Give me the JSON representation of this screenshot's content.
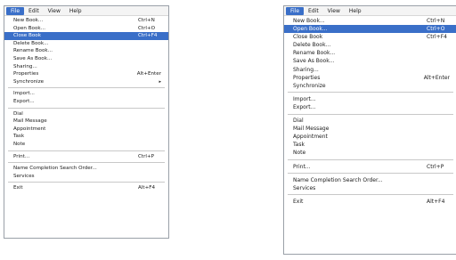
{
  "menubar": [
    "File",
    "Edit",
    "View",
    "Help"
  ],
  "left_panel": {
    "items": [
      {
        "label": "New Book...",
        "shortcut": "Ctrl+N"
      },
      {
        "label": "Open Book...",
        "shortcut": "Ctrl+O"
      },
      {
        "label": "Close Book",
        "shortcut": "Ctrl+F4"
      },
      {
        "label": "Delete Book..."
      },
      {
        "label": "Rename Book..."
      },
      {
        "label": "Save As Book..."
      },
      {
        "label": "Sharing..."
      },
      {
        "label": "Properties",
        "shortcut": "Alt+Enter"
      },
      {
        "label": "Synchronize",
        "arrow": "▸"
      },
      {
        "label": "Import..."
      },
      {
        "label": "Export..."
      },
      {
        "label": "Dial"
      },
      {
        "label": "Mail Message"
      },
      {
        "label": "Appointment"
      },
      {
        "label": "Task"
      },
      {
        "label": "Note"
      },
      {
        "label": "Print...",
        "shortcut": "Ctrl+P"
      },
      {
        "label": "Name Completion Search Order..."
      },
      {
        "label": "Services"
      },
      {
        "label": "Exit",
        "shortcut": "Alt+F4"
      }
    ],
    "highlighted_index": 2
  },
  "right_panel": {
    "items": [
      {
        "label": "New Book...",
        "shortcut": "Ctrl+N"
      },
      {
        "label": "Open Book...",
        "shortcut": "Ctrl+O"
      },
      {
        "label": "Close Book",
        "shortcut": "Ctrl+F4"
      },
      {
        "label": "Delete Book..."
      },
      {
        "label": "Rename Book..."
      },
      {
        "label": "Save As Book..."
      },
      {
        "label": "Sharing..."
      },
      {
        "label": "Properties",
        "shortcut": "Alt+Enter"
      },
      {
        "label": "Synchronize"
      },
      {
        "label": "Import..."
      },
      {
        "label": "Export..."
      },
      {
        "label": "Dial"
      },
      {
        "label": "Mail Message"
      },
      {
        "label": "Appointment"
      },
      {
        "label": "Task"
      },
      {
        "label": "Note"
      },
      {
        "label": "Print...",
        "shortcut": "Ctrl+P"
      },
      {
        "label": "Name Completion Search Order..."
      },
      {
        "label": "Services"
      },
      {
        "label": "Exit",
        "shortcut": "Alt+F4"
      }
    ],
    "highlighted_index": 1
  },
  "colors": {
    "highlight": "#3a6fc8",
    "highlight_text": "#ffffff",
    "separator": "#c8c8c8"
  }
}
